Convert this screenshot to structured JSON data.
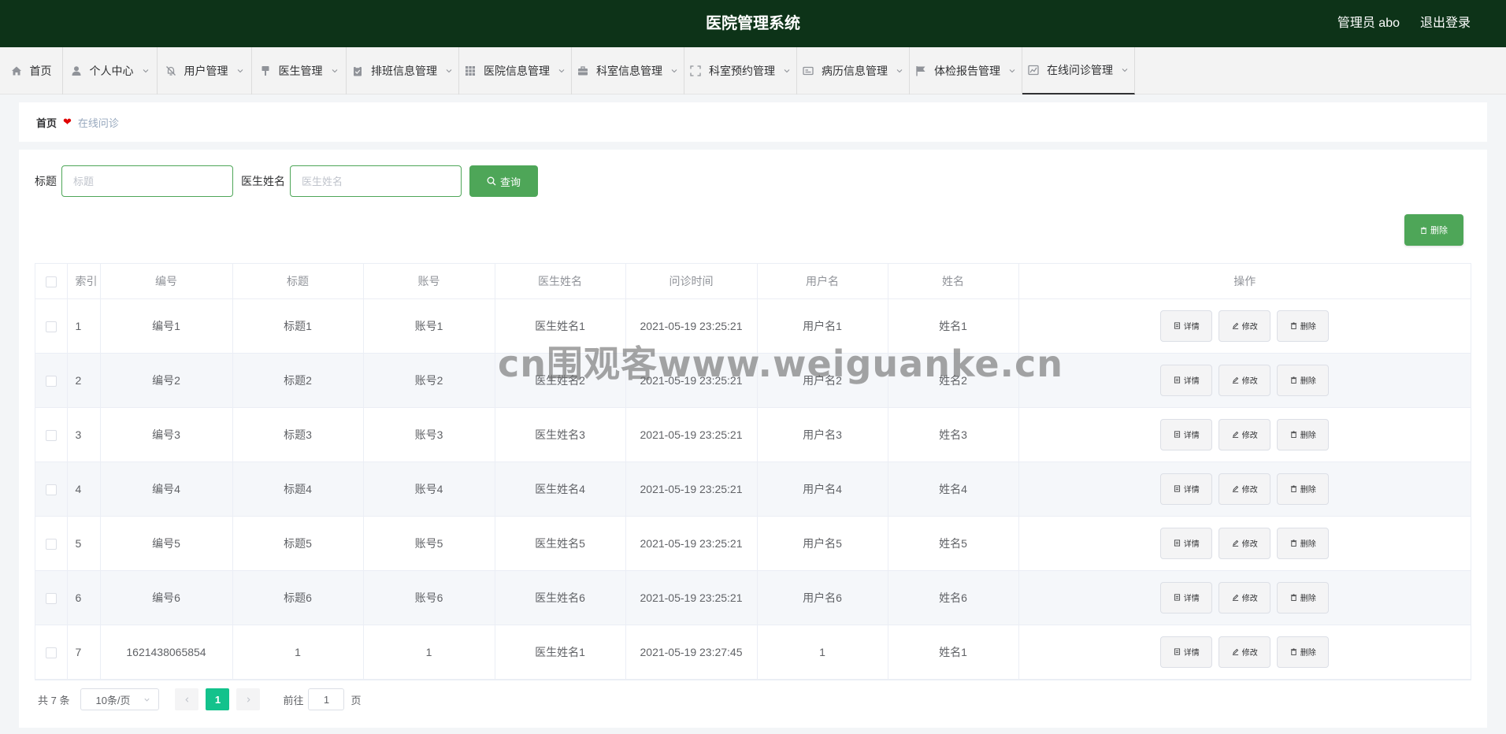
{
  "header": {
    "title": "医院管理系统",
    "user": "管理员 abo",
    "logout": "退出登录"
  },
  "nav": [
    {
      "label": "首页",
      "icon": "home-icon",
      "dropdown": false
    },
    {
      "label": "个人中心",
      "icon": "user-icon",
      "dropdown": true
    },
    {
      "label": "用户管理",
      "icon": "bell-off-icon",
      "dropdown": true
    },
    {
      "label": "医生管理",
      "icon": "brush-icon",
      "dropdown": true
    },
    {
      "label": "排班信息管理",
      "icon": "clipboard-check-icon",
      "dropdown": true
    },
    {
      "label": "医院信息管理",
      "icon": "grid-icon",
      "dropdown": true
    },
    {
      "label": "科室信息管理",
      "icon": "briefcase-icon",
      "dropdown": true
    },
    {
      "label": "科室预约管理",
      "icon": "fullscreen-icon",
      "dropdown": true
    },
    {
      "label": "病历信息管理",
      "icon": "id-card-icon",
      "dropdown": true
    },
    {
      "label": "体检报告管理",
      "icon": "flag-icon",
      "dropdown": true
    },
    {
      "label": "在线问诊管理",
      "icon": "chart-icon",
      "dropdown": true,
      "active": true
    }
  ],
  "breadcrumb": {
    "home": "首页",
    "current": "在线问诊"
  },
  "search": {
    "title_label": "标题",
    "title_placeholder": "标题",
    "doctor_label": "医生姓名",
    "doctor_placeholder": "医生姓名",
    "query_button": "查询"
  },
  "toolbar": {
    "delete_label": "删除"
  },
  "table": {
    "columns": [
      "索引",
      "编号",
      "标题",
      "账号",
      "医生姓名",
      "问诊时间",
      "用户名",
      "姓名",
      "操作"
    ],
    "rows": [
      {
        "index": "1",
        "code": "编号1",
        "title": "标题1",
        "account": "账号1",
        "doctor": "医生姓名1",
        "time": "2021-05-19 23:25:21",
        "username": "用户名1",
        "name": "姓名1"
      },
      {
        "index": "2",
        "code": "编号2",
        "title": "标题2",
        "account": "账号2",
        "doctor": "医生姓名2",
        "time": "2021-05-19 23:25:21",
        "username": "用户名2",
        "name": "姓名2"
      },
      {
        "index": "3",
        "code": "编号3",
        "title": "标题3",
        "account": "账号3",
        "doctor": "医生姓名3",
        "time": "2021-05-19 23:25:21",
        "username": "用户名3",
        "name": "姓名3"
      },
      {
        "index": "4",
        "code": "编号4",
        "title": "标题4",
        "account": "账号4",
        "doctor": "医生姓名4",
        "time": "2021-05-19 23:25:21",
        "username": "用户名4",
        "name": "姓名4"
      },
      {
        "index": "5",
        "code": "编号5",
        "title": "标题5",
        "account": "账号5",
        "doctor": "医生姓名5",
        "time": "2021-05-19 23:25:21",
        "username": "用户名5",
        "name": "姓名5"
      },
      {
        "index": "6",
        "code": "编号6",
        "title": "标题6",
        "account": "账号6",
        "doctor": "医生姓名6",
        "time": "2021-05-19 23:25:21",
        "username": "用户名6",
        "name": "姓名6"
      },
      {
        "index": "7",
        "code": "1621438065854",
        "title": "1",
        "account": "1",
        "doctor": "医生姓名1",
        "time": "2021-05-19 23:27:45",
        "username": "1",
        "name": "姓名1"
      }
    ],
    "actions": {
      "detail": "详情",
      "edit": "修改",
      "delete": "删除"
    }
  },
  "pagination": {
    "total": "共 7 条",
    "page_size": "10条/页",
    "current_page": "1",
    "goto_label": "前往",
    "goto_value": "1",
    "page_suffix": "页"
  },
  "watermark": "cn围观客www.weiguanke.cn",
  "colors": {
    "header_bg": "#0d3318",
    "accent": "#4ea658",
    "page_active": "#13c28c"
  }
}
